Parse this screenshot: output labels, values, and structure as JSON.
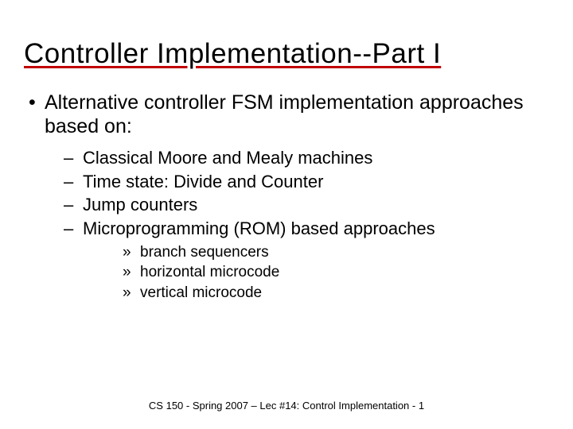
{
  "title": "Controller Implementation--Part I",
  "bullet1": "Alternative controller FSM implementation approaches based on:",
  "sub": {
    "a": "Classical Moore and Mealy machines",
    "b": "Time state: Divide and Counter",
    "c": "Jump counters",
    "d": "Microprogramming (ROM) based approaches"
  },
  "subsub": {
    "a": "branch sequencers",
    "b": "horizontal microcode",
    "c": "vertical microcode"
  },
  "footer": "CS 150 - Spring 2007 – Lec #14: Control Implementation - 1"
}
